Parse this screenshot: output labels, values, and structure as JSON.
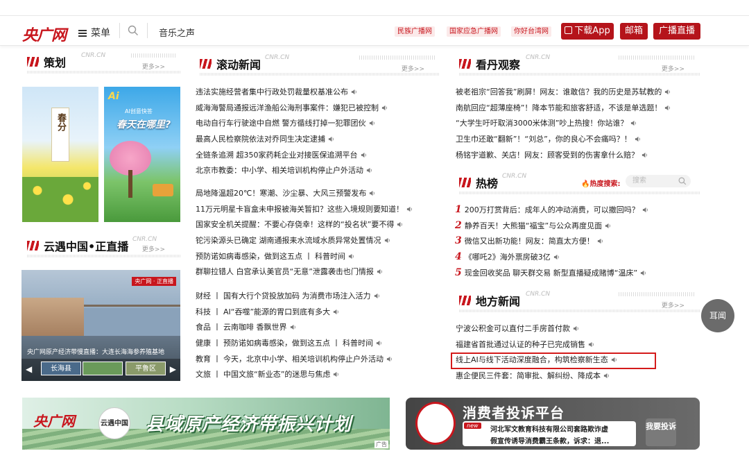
{
  "header": {
    "logo": "央广网",
    "menu_label": "菜单",
    "top_link": "音乐之声",
    "pills": [
      "民族广播网",
      "国家应急广播网",
      "你好台湾网"
    ],
    "app_button": "下载App",
    "mail_button": "邮箱",
    "live_button": "广播直播"
  },
  "sections": {
    "cehua": {
      "title": "策划",
      "en": "CNR.CN",
      "more": "更多>>"
    },
    "gundong": {
      "title": "滚动新闻",
      "en": "CNR.CN",
      "more": "更多>>"
    },
    "kandan": {
      "title": "看丹观察",
      "en": "CNR.CN",
      "more": "更多>>"
    },
    "rebang": {
      "title": "热榜",
      "en": "CNR.CN",
      "hot_label": "热度搜索:",
      "search_placeholder": "搜索"
    },
    "yunyu": {
      "title": "云遇中国•正直播",
      "en": "CNR.CN",
      "more": "更多>>"
    },
    "difang": {
      "title": "地方新闻",
      "en": "CNR.CN",
      "more": "更多>>"
    }
  },
  "posters": {
    "left_text": "春分",
    "right_badge": "AI创意快答",
    "right_title": "春天在哪里?"
  },
  "live": {
    "badge": "央广网 · 正直播",
    "caption": "央广网原产经济带慢直播：大连长海海参养殖基地",
    "thumbs": [
      "长海县",
      "",
      "平鲁区"
    ]
  },
  "rolling_news_1": [
    "违法实施经营者集中行政处罚裁量权基准公布",
    "威海海警局通报远洋渔船公海刑事案件：嫌犯已被控制",
    "电动自行车行驶途中自燃 警方循线打掉一犯罪团伙",
    "最高人民检察院依法对乔同生决定逮捕",
    "全链条追溯 超350家药耗企业对接医保追溯平台",
    "北京市教委：中小学、相关培训机构停止户外活动"
  ],
  "rolling_news_2": [
    "局地降温超20℃！寒潮、沙尘暴、大风三预警发布",
    "11万元明星卡盲盒未申报被海关暂扣？这些入境规则要知道！",
    "国家安全机关提醒：不要心存侥幸！这样的“投名状”要不得",
    "铊污染源头已确定 湖南通报耒水流域水质异常处置情况",
    "预防诺如病毒感染，做到这五点 丨 科普时间",
    "群聊拉错人 白宫承认美官员“无意”泄露袭击也门情报"
  ],
  "category_news": [
    {
      "cat": "财经",
      "text": "国有大行个贷投放加码 为消费市场注入活力"
    },
    {
      "cat": "科技",
      "text": "AI“吞噬”能源的胃口到底有多大"
    },
    {
      "cat": "食品",
      "text": "云南咖啡 香飘世界"
    },
    {
      "cat": "健康",
      "text": "预防诺如病毒感染，做到这五点 丨 科普时间"
    },
    {
      "cat": "教育",
      "text": "今天，北京中小学、相关培训机构停止户外活动"
    },
    {
      "cat": "文旅",
      "text": "中国文旅“新业态”的迷思与焦虑"
    }
  ],
  "kandan_news": [
    "被老祖宗“回答我”刷屏！网友：谁敢信？我的历史是苏轼教的",
    "南航回应“超薄座椅”！降本节能和旅客舒适，不该是单选题！",
    "“大学生吁吁取消3000米体测”吵上热搜！你站谁？",
    "卫生巾还敢“翻新”！“刘总”，你的良心不会痛吗？！",
    "杨铭宇道歉、关店！网友：顾客受到的伤害拿什么赔？"
  ],
  "hot_list": [
    {
      "rank": "1",
      "text": "200万打赏背后：成年人的冲动消费，可以撤回吗？"
    },
    {
      "rank": "2",
      "text": "静养百天！大熊猫“福宝”与公众再度见面"
    },
    {
      "rank": "3",
      "text": "微信又出新功能！网友：简直太方便！"
    },
    {
      "rank": "4",
      "text": "《哪吒2》海外票房破3亿"
    },
    {
      "rank": "5",
      "text": "现金回收奖品 聊天群交易 新型直播疑成赌博“温床”"
    }
  ],
  "local_news": [
    "宁波公积金可以直付二手房首付款",
    "福建省首批通过认证的种子已完成销售",
    "线上AI与线下活动深度融合，构筑检察新生态",
    "惠企便民三件套：简审批、解纠纷、降成本"
  ],
  "ad1": {
    "logo": "央广网",
    "seal": "云遇中国",
    "slogan": "县域原产经济带振兴计划",
    "tag": "广告"
  },
  "ad2": {
    "title": "消费者投诉平台",
    "new_tag": "new",
    "line1": "河北军文教育科技有限公司套路欺诈虚",
    "line2": "假宣传诱导消费霸王条款，诉求：退...",
    "button": "我要投诉"
  },
  "float_button": "耳闻",
  "colors": {
    "brand_red": "#c8161d",
    "highlight_box": "#d41a1a"
  }
}
